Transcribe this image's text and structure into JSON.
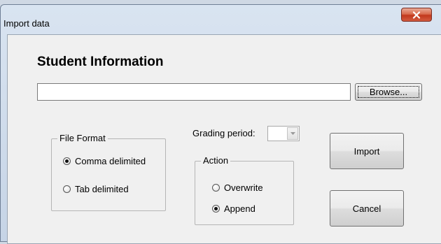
{
  "window": {
    "title": "Import data",
    "close_glyph": "x"
  },
  "form": {
    "heading": "Student Information",
    "path_value": "",
    "browse_label": "Browse...",
    "grading_label": "Grading period:",
    "grading_value": "",
    "import_label": "Import",
    "cancel_label": "Cancel"
  },
  "file_format": {
    "legend": "File Format",
    "options": [
      {
        "label": "Comma delimited",
        "checked": true
      },
      {
        "label": "Tab delimited",
        "checked": false
      }
    ]
  },
  "action": {
    "legend": "Action",
    "options": [
      {
        "label": "Overwrite",
        "checked": false
      },
      {
        "label": "Append",
        "checked": true
      }
    ]
  }
}
